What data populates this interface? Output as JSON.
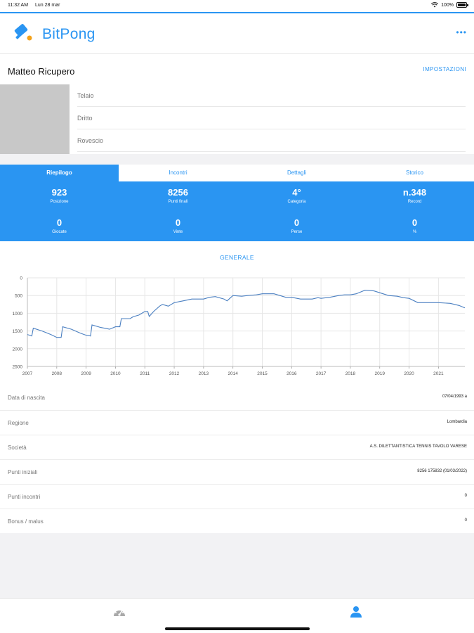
{
  "status_bar": {
    "time": "11:32 AM",
    "date": "Lun 28 mar",
    "battery": "100%",
    "wifi_icon": "wifi-icon",
    "battery_icon": "battery-icon"
  },
  "app": {
    "brand": "BitPong",
    "more_label": "•••",
    "accent_color": "#2a95f2"
  },
  "profile": {
    "name": "Matteo Ricupero",
    "settings_label": "IMPOSTAZIONI",
    "rows": [
      "Telaio",
      "Dritto",
      "Rovescio"
    ]
  },
  "tabs": [
    {
      "label": "Riepilogo",
      "active": true
    },
    {
      "label": "Incontri",
      "active": false
    },
    {
      "label": "Dettagli",
      "active": false
    },
    {
      "label": "Storico",
      "active": false
    }
  ],
  "stats": {
    "row1": [
      {
        "value": "923",
        "label": "Posizione"
      },
      {
        "value": "8256",
        "label": "Punti finali"
      },
      {
        "value": "4°",
        "label": "Categoria"
      },
      {
        "value": "n.348",
        "label": "Record"
      }
    ],
    "row2": [
      {
        "value": "0",
        "label": "Giocate"
      },
      {
        "value": "0",
        "label": "Vinte"
      },
      {
        "value": "0",
        "label": "Perse"
      },
      {
        "value": "0",
        "label": "%"
      }
    ]
  },
  "chart_data": {
    "type": "line",
    "title": "GENERALE",
    "xlabel": "",
    "ylabel": "",
    "x_ticks": [
      "2007",
      "2008",
      "2009",
      "2010",
      "2011",
      "2012",
      "2013",
      "2014",
      "2015",
      "2016",
      "2017",
      "2018",
      "2019",
      "2020",
      "2021"
    ],
    "y_ticks": [
      "0",
      "500",
      "1000",
      "1500",
      "2000",
      "2500"
    ],
    "ylim": [
      0,
      2500
    ],
    "y_inverted": true,
    "xlim": [
      2007,
      2021.9
    ],
    "grid": true,
    "line_color": "#4a7fc1",
    "series": [
      {
        "x": [
          2007.0,
          2007.15,
          2007.2,
          2007.5,
          2007.8,
          2008.0,
          2008.15,
          2008.2,
          2008.5,
          2008.8,
          2009.0,
          2009.15,
          2009.2,
          2009.5,
          2009.8,
          2010.0,
          2010.15,
          2010.2,
          2010.5,
          2010.6,
          2010.8,
          2011.0,
          2011.1,
          2011.15,
          2011.3,
          2011.5,
          2011.6,
          2011.8,
          2012.0,
          2012.3,
          2012.6,
          2013.0,
          2013.2,
          2013.4,
          2013.7,
          2013.8,
          2014.0,
          2014.3,
          2014.5,
          2014.8,
          2015.0,
          2015.4,
          2015.6,
          2015.8,
          2016.0,
          2016.3,
          2016.5,
          2016.7,
          2016.9,
          2017.0,
          2017.3,
          2017.6,
          2017.8,
          2018.0,
          2018.2,
          2018.5,
          2018.8,
          2019.0,
          2019.3,
          2019.6,
          2019.8,
          2020.0,
          2020.3,
          2020.6,
          2021.0,
          2021.4,
          2021.7,
          2021.9
        ],
        "y": [
          1600,
          1640,
          1420,
          1500,
          1600,
          1680,
          1680,
          1380,
          1450,
          1560,
          1620,
          1640,
          1330,
          1400,
          1450,
          1380,
          1380,
          1150,
          1150,
          1100,
          1050,
          950,
          950,
          1090,
          950,
          800,
          750,
          800,
          700,
          650,
          600,
          600,
          550,
          530,
          600,
          650,
          500,
          520,
          500,
          480,
          450,
          450,
          500,
          550,
          550,
          600,
          600,
          600,
          560,
          580,
          550,
          500,
          480,
          480,
          450,
          350,
          370,
          420,
          500,
          520,
          560,
          580,
          700,
          700,
          700,
          720,
          780,
          850
        ]
      }
    ]
  },
  "info": [
    {
      "label": "Data di nascita",
      "value": "07/04/1993 a"
    },
    {
      "label": "Regione",
      "value": "Lombardia"
    },
    {
      "label": "Società",
      "value": "A.S. DILETTANTISTICA TENNIS TAVOLO VARESE"
    },
    {
      "label": "Punti iniziali",
      "value": "8256 175832 (01/03/2022)"
    },
    {
      "label": "Punti incontri",
      "value": "0"
    },
    {
      "label": "Bonus / malus",
      "value": "0"
    }
  ],
  "bottom_nav": [
    {
      "icon": "dashboard-icon",
      "active": false,
      "color": "#9a9a9a"
    },
    {
      "icon": "user-icon",
      "active": true,
      "color": "#2a95f2"
    }
  ]
}
